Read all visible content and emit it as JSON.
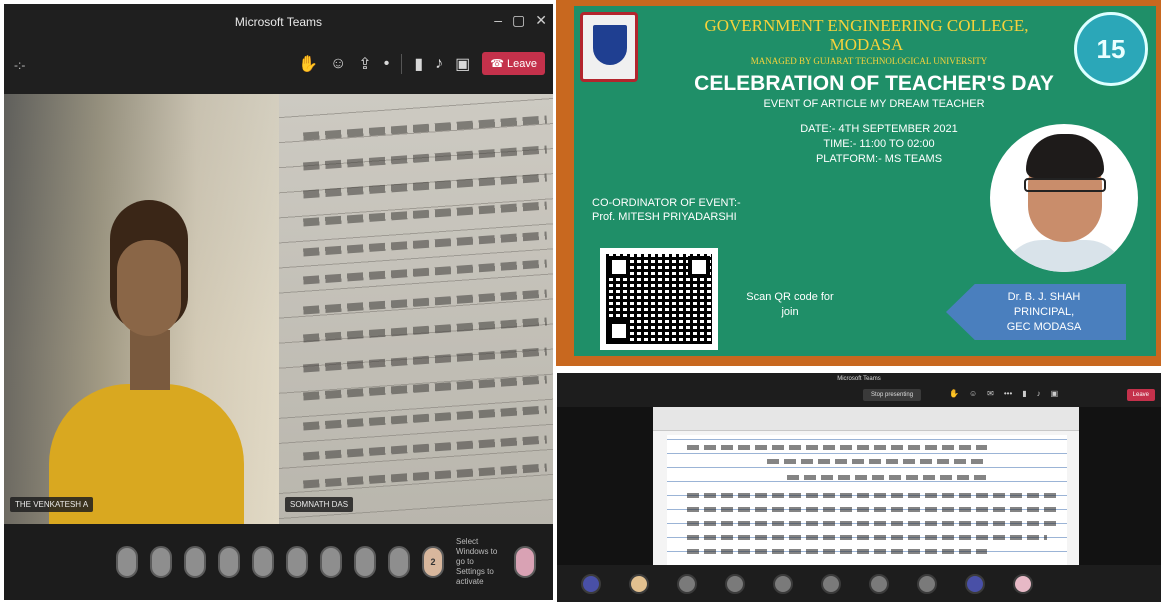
{
  "left_window": {
    "title": "Microsoft Teams",
    "toolbar_left": "-:-",
    "leave_label": "Leave",
    "person_tag": "THE VENKATESH A",
    "notebook_tag": "SOMNATH DAS",
    "self_avatar_initial": "2",
    "scroll_text": "Select Windows to go to Settings to activate"
  },
  "poster": {
    "college": "GOVERNMENT ENGINEERING COLLEGE, MODASA",
    "managed_by": "MANAGED BY GUJARAT TECHNOLOGICAL UNIVERSITY",
    "title": "CELEBRATION OF TEACHER'S DAY",
    "event": "EVENT OF ARTICLE MY DREAM TEACHER",
    "date": "DATE:- 4TH SEPTEMBER 2021",
    "time": "TIME:- 11:00 TO 02:00",
    "platform": "PLATFORM:- MS TEAMS",
    "coordinator_label": "CO-ORDINATOR OF EVENT:-",
    "coordinator_name": "Prof. MITESH PRIYADARSHI",
    "scan_text": "Scan QR code for join",
    "principal_name": "Dr. B. J. SHAH",
    "principal_role": "PRINCIPAL,",
    "principal_org": "GEC MODASA",
    "logo_right_text": "15"
  },
  "right_window": {
    "title": "Microsoft Teams",
    "stop_presenting": "Stop presenting",
    "leave_label": "Leave"
  }
}
